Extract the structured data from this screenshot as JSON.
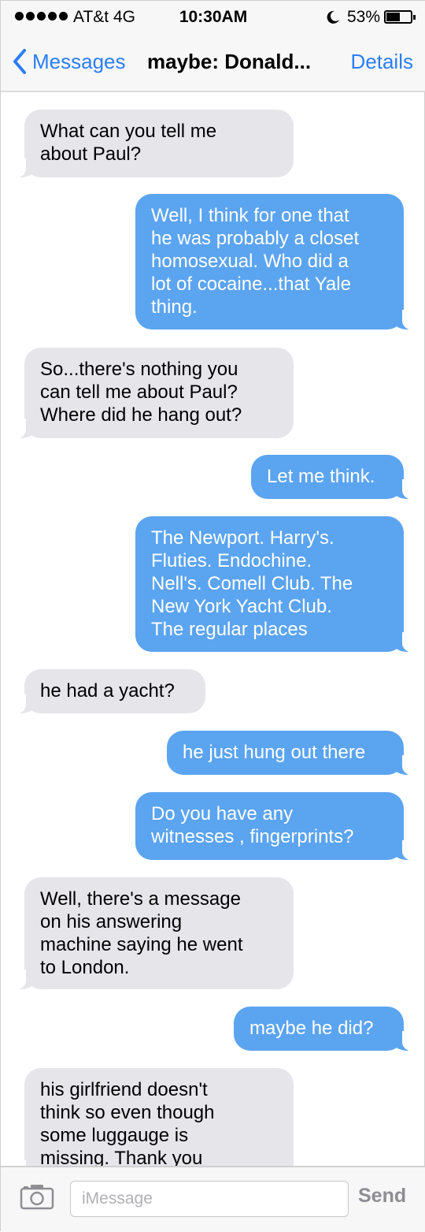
{
  "status_bar": {
    "carrier": "AT&t  4G",
    "time": "10:30AM",
    "battery_percent_text": "53%",
    "battery_level": 0.53,
    "signal_bars": 5,
    "icons": [
      "signal-dots-icon",
      "moon-icon",
      "battery-icon"
    ]
  },
  "nav": {
    "back_label": "Messages",
    "title": "maybe: Donald...",
    "details_label": "Details"
  },
  "messages": [
    {
      "direction": "incoming",
      "text": "What can you tell me\nabout Paul?"
    },
    {
      "direction": "outgoing",
      "text": "Well, I think for one that\nhe was probably a closet\nhomosexual. Who did a\nlot of cocaine...that Yale\nthing."
    },
    {
      "direction": "incoming",
      "text": "So...there's nothing you\ncan tell me about Paul?\nWhere did he hang out?"
    },
    {
      "direction": "outgoing",
      "text": "Let me think."
    },
    {
      "direction": "outgoing",
      "text": "The Newport. Harry's.\nFluties. Endochine.\nNell's. Comell Club. The\nNew York Yacht Club.\nThe regular places"
    },
    {
      "direction": "incoming",
      "text": "he had a yacht?"
    },
    {
      "direction": "outgoing",
      "text": "he just hung out there"
    },
    {
      "direction": "outgoing",
      "text": "Do you have any\nwitnesses , fingerprints?"
    },
    {
      "direction": "incoming",
      "text": "Well, there's a message\non his answering\nmachine saying he went\nto London."
    },
    {
      "direction": "outgoing",
      "text": "maybe he did?"
    },
    {
      "direction": "incoming",
      "text": "his girlfriend doesn't\nthink so even though\nsome luggauge is\nmissing. Thank you"
    }
  ],
  "input_bar": {
    "placeholder": "iMessage",
    "send_label": "Send",
    "camera_icon": "camera-icon"
  },
  "colors": {
    "incoming_bubble": "#e5e5ea",
    "outgoing_bubble": "#5ba4f0",
    "accent": "#2a7ef5",
    "send_disabled": "#8e8e93"
  }
}
